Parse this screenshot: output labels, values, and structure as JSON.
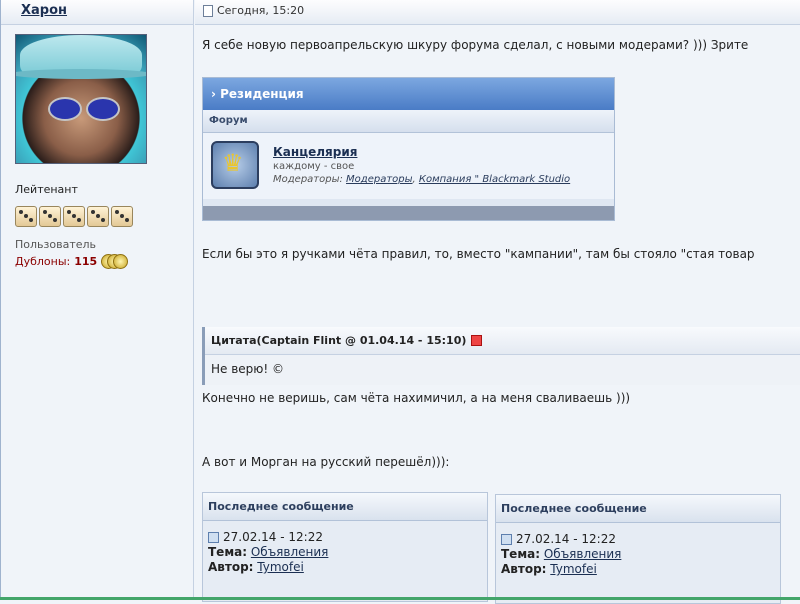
{
  "author": {
    "name": "Харон",
    "rank": "Лейтенант",
    "group": "Пользователь",
    "money_label": "Дублоны:",
    "money_value": "115",
    "rank_dice_count": 5
  },
  "post": {
    "time": "Сегодня, 15:20",
    "line1": "Я себе новую первоапрельскую шкуру форума сделал, с новыми модерами? ))) Зрите",
    "line2": "Если бы это я ручками чёта правил, то, вместо \"кампании\", там бы стояло \"стая товар",
    "line3": "Конечно не веришь, сам чёта нахимичил, а на меня сваливаешь )))",
    "line4": "А вот и Морган на русский перешёл))):"
  },
  "forum_image": {
    "header": "Резиденция",
    "subheader": "Форум",
    "forum_title": "Канцелярия",
    "forum_desc": "каждому - свое",
    "mods_label": "Модераторы:",
    "mod1": "Модераторы",
    "mod2": "Компания \" Blackmark Studio"
  },
  "quote": {
    "header": "Цитата(Captain Flint @ 01.04.14 - 15:10)",
    "body": "Не верю! ©"
  },
  "last_posts": [
    {
      "header": "Последнее сообщение",
      "date": "27.02.14 - 12:22",
      "topic_label": "Тема:",
      "topic": "Объявления",
      "author_label": "Автор:",
      "author": "Tymofei"
    },
    {
      "header": "Последнее сообщение",
      "date": "27.02.14 - 12:22",
      "topic_label": "Тема:",
      "topic": "Объявления",
      "author_label": "Автор:",
      "author": "Tymofei"
    }
  ]
}
